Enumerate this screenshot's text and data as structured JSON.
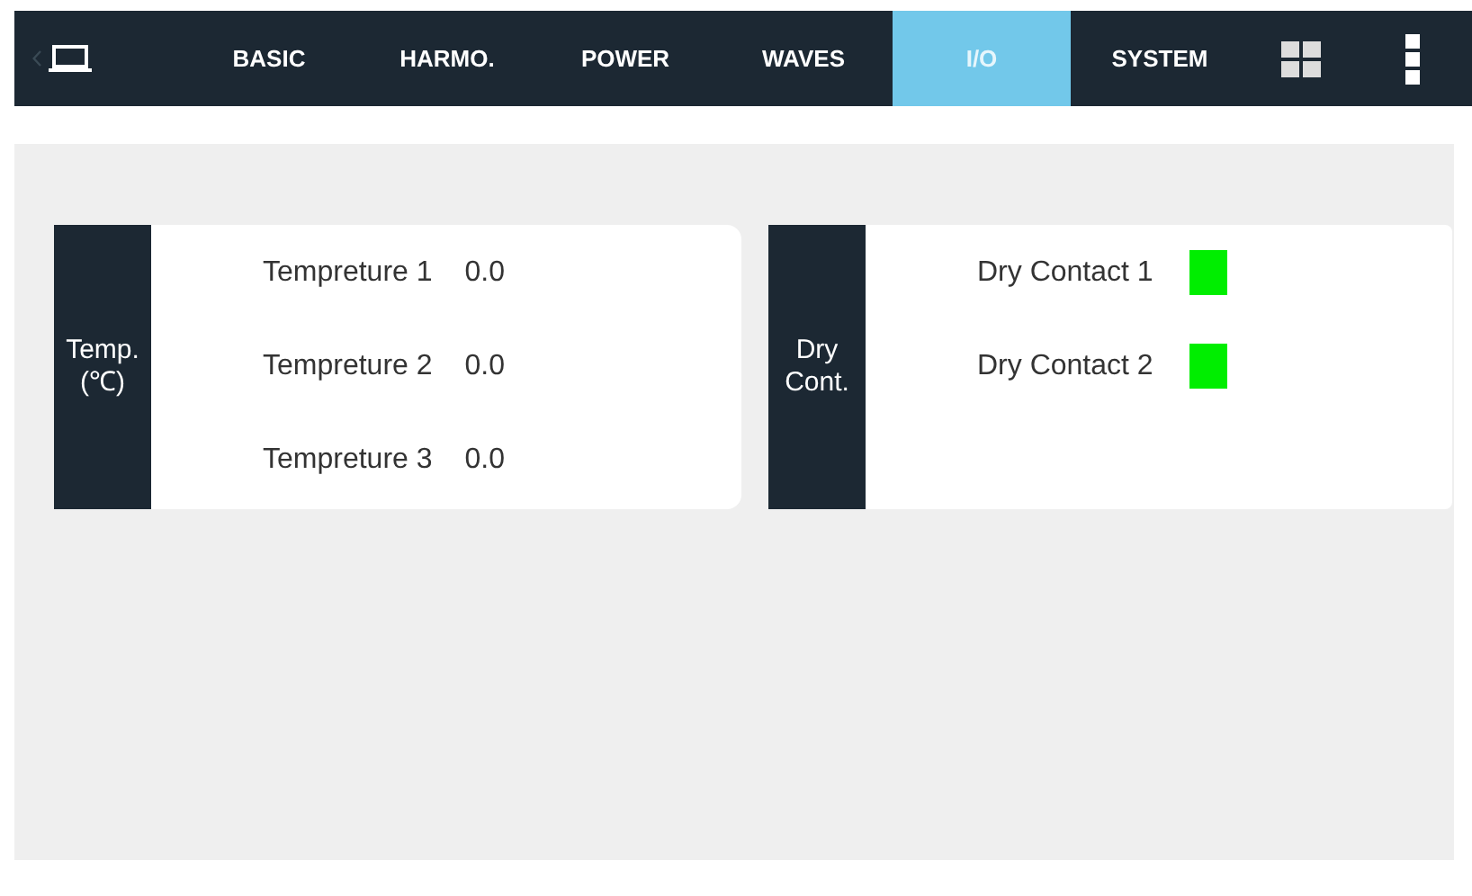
{
  "tabs": [
    {
      "label": "BASIC",
      "selected": false
    },
    {
      "label": "HARMO.",
      "selected": false
    },
    {
      "label": "POWER",
      "selected": false
    },
    {
      "label": "WAVES",
      "selected": false
    },
    {
      "label": "I/O",
      "selected": true
    },
    {
      "label": "SYSTEM",
      "selected": false
    }
  ],
  "temperature": {
    "title_lines": [
      "Temp.",
      "(℃)"
    ],
    "rows": [
      {
        "label": "Tempreture 1",
        "value": "0.0"
      },
      {
        "label": "Tempreture 2",
        "value": "0.0"
      },
      {
        "label": "Tempreture 3",
        "value": "0.0"
      }
    ]
  },
  "dry_contact": {
    "title_lines": [
      "Dry",
      "Cont."
    ],
    "rows": [
      {
        "label": "Dry Contact 1",
        "color": "#00ee00"
      },
      {
        "label": "Dry Contact 2",
        "color": "#00ee00"
      }
    ]
  }
}
